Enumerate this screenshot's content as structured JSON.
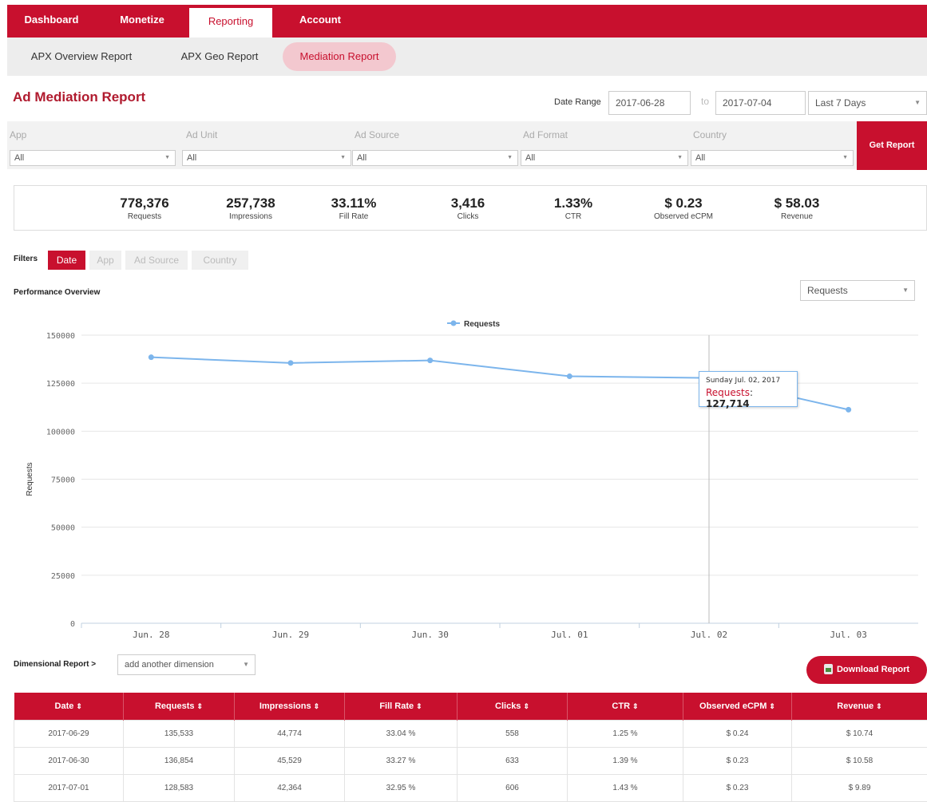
{
  "nav": {
    "tabs": [
      "Dashboard",
      "Monetize",
      "Reporting",
      "Account"
    ],
    "active": "Reporting"
  },
  "subnav": {
    "items": [
      "APX Overview Report",
      "APX Geo Report",
      "Mediation Report"
    ],
    "active": "Mediation Report"
  },
  "page": {
    "title": "Ad Mediation Report",
    "date_range_label": "Date Range",
    "date_from": "2017-06-28",
    "to_label": "to",
    "date_to": "2017-07-04",
    "preset": "Last 7 Days"
  },
  "filters_row": {
    "columns": [
      {
        "label": "App",
        "value": "All"
      },
      {
        "label": "Ad Unit",
        "value": "All"
      },
      {
        "label": "Ad Source",
        "value": "All"
      },
      {
        "label": "Ad Format",
        "value": "All"
      },
      {
        "label": "Country",
        "value": "All"
      }
    ],
    "get_report": "Get Report"
  },
  "summary": [
    {
      "value": "778,376",
      "label": "Requests"
    },
    {
      "value": "257,738",
      "label": "Impressions"
    },
    {
      "value": "33.11%",
      "label": "Fill Rate"
    },
    {
      "value": "3,416",
      "label": "Clicks"
    },
    {
      "value": "1.33%",
      "label": "CTR"
    },
    {
      "value": "$ 0.23",
      "label": "Observed eCPM"
    },
    {
      "value": "$ 58.03",
      "label": "Revenue"
    }
  ],
  "filter_pills": {
    "label": "Filters",
    "items": [
      "Date",
      "App",
      "Ad Source",
      "Country"
    ],
    "active": "Date"
  },
  "performance": {
    "label": "Performance Overview",
    "metric_select": "Requests"
  },
  "chart_data": {
    "type": "line",
    "categories": [
      "Jun. 28",
      "Jun. 29",
      "Jun. 30",
      "Jul. 01",
      "Jul. 02",
      "Jul. 03"
    ],
    "series": [
      {
        "name": "Requests",
        "values": [
          138500,
          135533,
          136854,
          128583,
          127714,
          111200
        ]
      }
    ],
    "ylabel": "Requests",
    "ylim": [
      0,
      150000
    ],
    "yticks": [
      0,
      25000,
      50000,
      75000,
      100000,
      125000,
      150000
    ],
    "grid": true,
    "legend": "top-center",
    "color": "#7cb5ec",
    "tooltip": {
      "date": "Sunday Jul. 02, 2017",
      "series": "Requests",
      "value": "127,714"
    }
  },
  "dimensional": {
    "label": "Dimensional Report",
    "arrow": ">",
    "select": "add another dimension",
    "download": "Download Report"
  },
  "table": {
    "headers": [
      "Date",
      "Requests",
      "Impressions",
      "Fill Rate",
      "Clicks",
      "CTR",
      "Observed eCPM",
      "Revenue"
    ],
    "sort_glyph": "⇕",
    "rows": [
      [
        "2017-06-29",
        "135,533",
        "44,774",
        "33.04 %",
        "558",
        "1.25 %",
        "$ 0.24",
        "$ 10.74"
      ],
      [
        "2017-06-30",
        "136,854",
        "45,529",
        "33.27 %",
        "633",
        "1.39 %",
        "$ 0.23",
        "$ 10.58"
      ],
      [
        "2017-07-01",
        "128,583",
        "42,364",
        "32.95 %",
        "606",
        "1.43 %",
        "$ 0.23",
        "$ 9.89"
      ]
    ]
  }
}
